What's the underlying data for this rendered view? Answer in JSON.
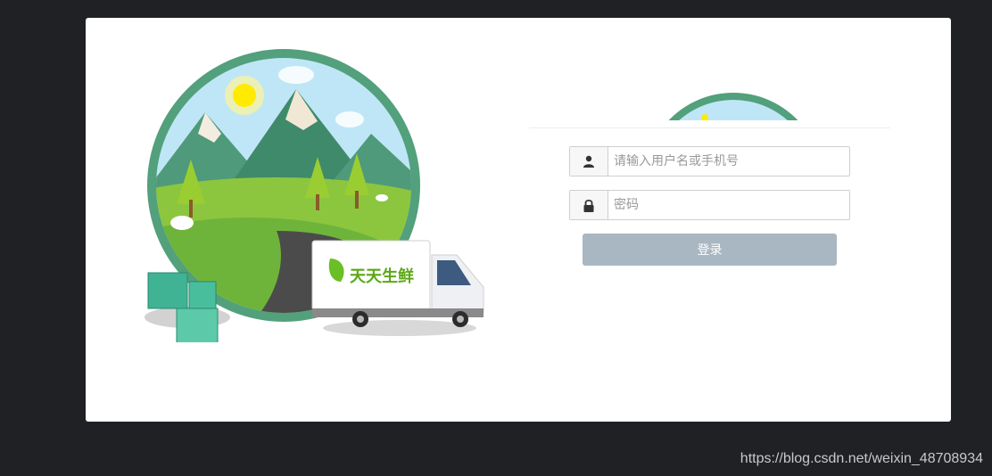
{
  "brand": {
    "logo_text": "天天生鲜"
  },
  "login": {
    "username_placeholder": "请输入用户名或手机号",
    "username_value": "",
    "password_placeholder": "密码",
    "password_value": "",
    "submit_label": "登录"
  },
  "watermark": "https://blog.csdn.net/weixin_48708934",
  "colors": {
    "page_background": "#1f2125",
    "card_background": "#ffffff",
    "button_background": "#a9b7c2",
    "ring_green": "#52a07c"
  },
  "icons": {
    "username": "user-icon",
    "password": "lock-icon"
  }
}
